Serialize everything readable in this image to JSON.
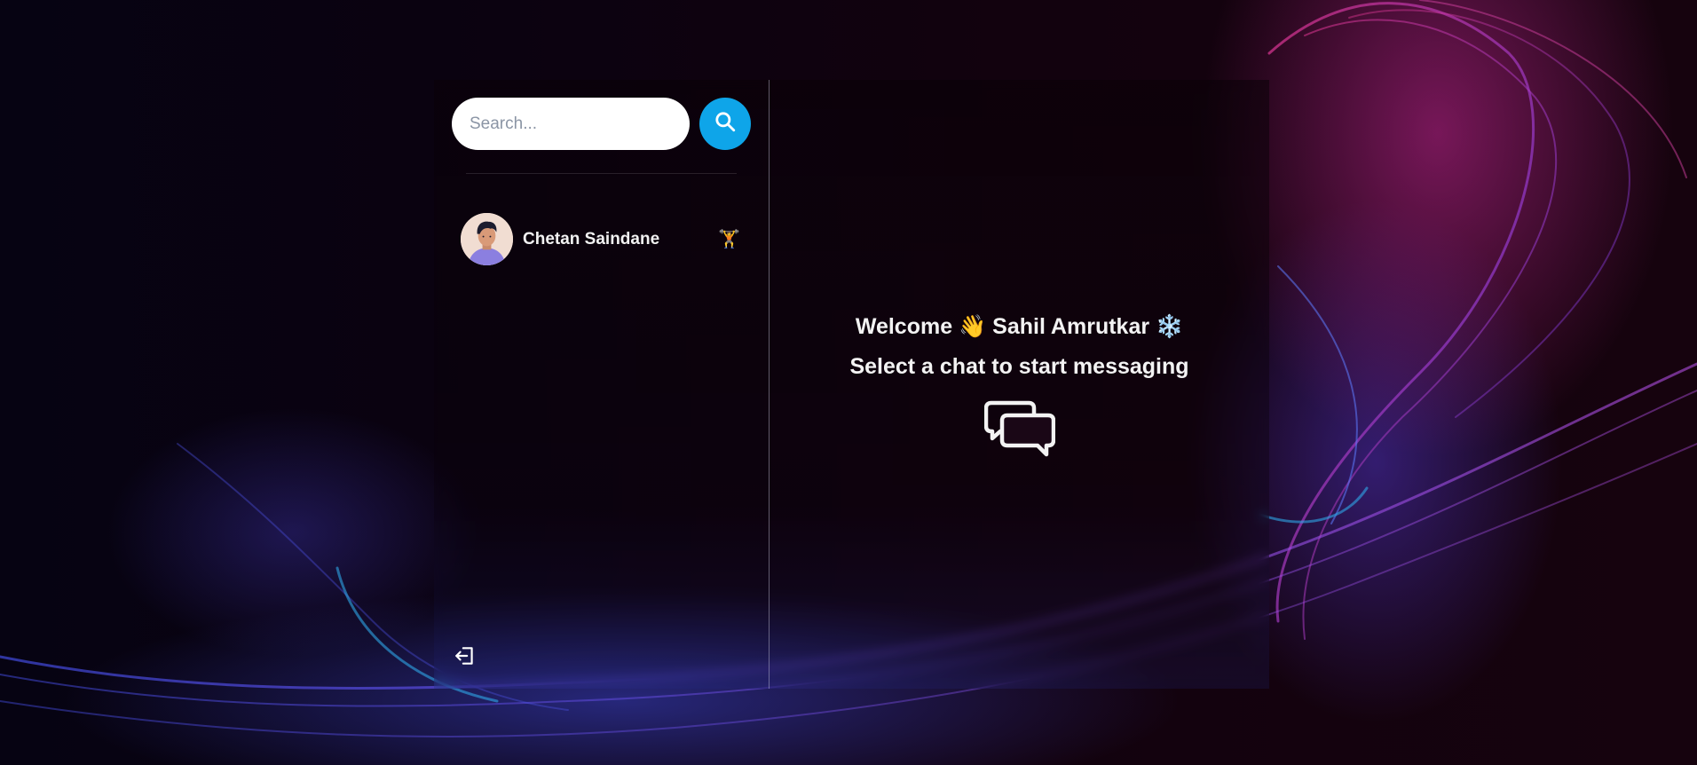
{
  "search": {
    "placeholder": "Search..."
  },
  "sidebar": {
    "conversations": [
      {
        "name": "Chetan Saindane",
        "emoji": "🏋️"
      }
    ]
  },
  "main": {
    "welcome_prefix": "Welcome",
    "wave_emoji": "👋",
    "user_name": "Sahil Amrutkar",
    "snow_emoji": "❄️",
    "prompt": "Select a chat to start messaging"
  },
  "colors": {
    "search_button": "#0ea5e9",
    "text": "#f3f3f3"
  },
  "icons": {
    "search": "search-icon",
    "logout": "logout-icon",
    "chat": "chat-bubbles-icon"
  }
}
